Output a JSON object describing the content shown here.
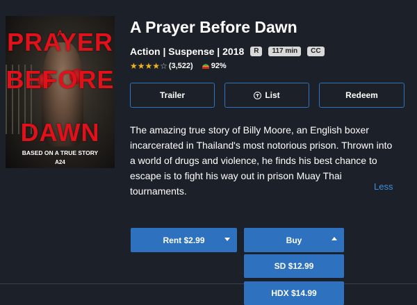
{
  "poster": {
    "title_line1": "A",
    "title_line2": "PRAYER",
    "title_line3": "BEFORE",
    "title_line4": "DAWN",
    "tagline": "BASED ON A TRUE STORY",
    "studio": "A24",
    "accent": "#e0111b"
  },
  "movie": {
    "title": "A Prayer Before Dawn",
    "genres": "Action | Suspense | 2018",
    "badges": [
      "R",
      "117 min",
      "CC"
    ],
    "rating_stars": 4,
    "rating_max": 5,
    "rating_count": "(3,522)",
    "tomatometer": "92%",
    "description": "The amazing true story of Billy Moore, an English boxer incarcerated in Thailand's most notorious prison. Thrown into a world of drugs and violence, he finds his best chance to escape is to fight his way out in prison Muay Thai tournaments.",
    "less_label": "Less"
  },
  "actions": {
    "trailer_label": "Trailer",
    "list_label": "List",
    "redeem_label": "Redeem",
    "rent_label": "Rent $2.99",
    "buy_label": "Buy",
    "buy_options": [
      "SD $12.99",
      "HDX $14.99"
    ]
  },
  "colors": {
    "background": "#1c2129",
    "button_blue": "#2e72bf",
    "outline_blue": "#2f74c0",
    "link_blue": "#3d8fe0",
    "star": "#f2b41e"
  }
}
